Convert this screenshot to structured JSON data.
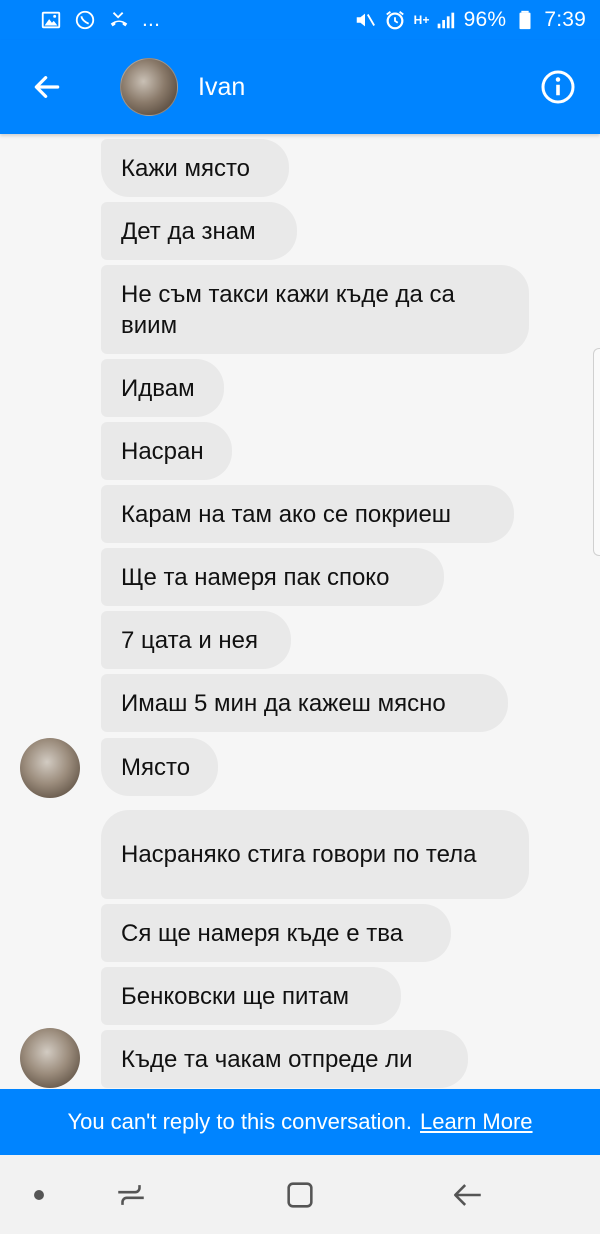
{
  "status_bar": {
    "notification_icons": [
      "image-icon",
      "whatsapp-icon",
      "missed-call-icon"
    ],
    "more_label": "...",
    "system_icons": [
      "mute-icon",
      "alarm-icon",
      "signal-icon"
    ],
    "network_label": "H+",
    "battery_label": "96%",
    "time": "7:39"
  },
  "header": {
    "contact_name": "Ivan"
  },
  "messages": [
    {
      "text": "Кажи място"
    },
    {
      "text": "Дет да знам"
    },
    {
      "text": "Не съм такси кажи къде да са виим"
    },
    {
      "text": "Идвам"
    },
    {
      "text": "Насран"
    },
    {
      "text": "Карам на там ако се покриеш"
    },
    {
      "text": "Ще та намеря пак споко"
    },
    {
      "text": "7 цата и нея"
    },
    {
      "text": "Имаш 5 мин да кажеш мясно"
    },
    {
      "text": "Място"
    },
    {
      "text": "Насраняко стига говори по тела"
    },
    {
      "text": "Ся ще намеря къде е тва"
    },
    {
      "text": "Бенковски ще питам"
    },
    {
      "text": "Къде та чакам отпреде ли"
    }
  ],
  "banner": {
    "text": "You can't reply to this conversation.",
    "link": "Learn More"
  },
  "colors": {
    "brand_blue": "#0084ff",
    "bubble_gray": "#e9e9e9",
    "background": "#f6f6f6"
  }
}
